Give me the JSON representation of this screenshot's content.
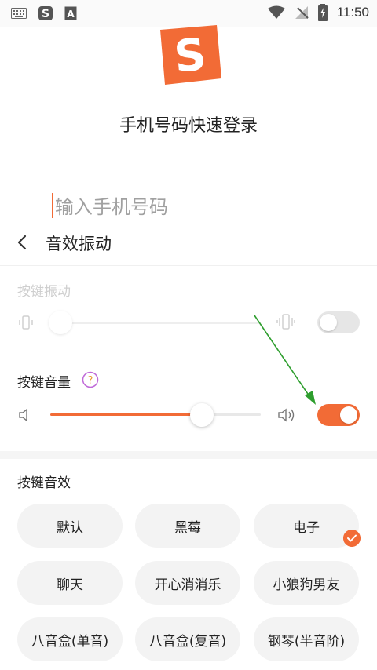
{
  "status_bar": {
    "time": "11:50",
    "icons": [
      "keyboard-icon",
      "sogou-s-icon",
      "a-notification-icon",
      "wifi-icon",
      "no-signal-icon",
      "battery-charging-icon"
    ]
  },
  "login": {
    "title": "手机号码快速登录",
    "phone_placeholder": "输入手机号码"
  },
  "header": {
    "title": "音效振动"
  },
  "vibration": {
    "label": "按键振动",
    "level": 0.05,
    "enabled": false
  },
  "volume": {
    "label": "按键音量",
    "level": 0.72,
    "enabled": true
  },
  "effects": {
    "label": "按键音效",
    "options": [
      "默认",
      "黑莓",
      "电子",
      "聊天",
      "开心消消乐",
      "小狼狗男友",
      "八音盒(单音)",
      "八音盒(复音)",
      "钢琴(半音阶)"
    ],
    "selected": "电子"
  },
  "colors": {
    "accent": "#f26b36",
    "annotation_arrow": "#2e9e2e"
  }
}
